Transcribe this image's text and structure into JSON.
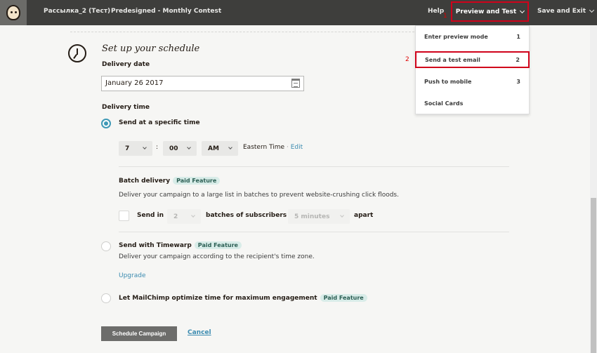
{
  "topbar": {
    "campaign_name": "Рассылка_2 (Тест)",
    "template_name": "Predesigned - Monthly Contest",
    "help_label": "Help",
    "preview_label": "Preview and Test",
    "save_exit_label": "Save and Exit",
    "annotation_1": "1"
  },
  "dropdown": {
    "annotation_2": "2",
    "items": [
      {
        "label": "Enter preview mode",
        "num": "1"
      },
      {
        "label": "Send a test email",
        "num": "2"
      },
      {
        "label": "Push to mobile",
        "num": "3"
      },
      {
        "label": "Social Cards",
        "num": ""
      }
    ]
  },
  "schedule": {
    "title": "Set up your schedule",
    "delivery_date_label": "Delivery date",
    "delivery_date_value": "January 26 2017",
    "delivery_time_label": "Delivery time",
    "specific_time_label": "Send at a specific time",
    "hour": "7",
    "minute": "00",
    "ampm": "AM",
    "timezone": "Eastern Time",
    "timezone_sep": " · ",
    "edit_label": "Edit"
  },
  "batch": {
    "title": "Batch delivery",
    "paid_label": "Paid Feature",
    "description": "Deliver your campaign to a large list in batches to prevent website-crushing click floods.",
    "send_in_label": "Send in",
    "batches_count": "2",
    "batches_of_label": "batches of subscribers",
    "interval": "5 minutes",
    "apart_label": "apart"
  },
  "timewarp": {
    "title": "Send with Timewarp",
    "paid_label": "Paid Feature",
    "description": "Deliver your campaign according to the recipient's time zone.",
    "upgrade_label": "Upgrade"
  },
  "optimize": {
    "title": "Let MailChimp optimize time for maximum engagement",
    "paid_label": "Paid Feature"
  },
  "actions": {
    "schedule_label": "Schedule Campaign",
    "cancel_label": "Cancel"
  },
  "colors": {
    "topbar_bg": "#3e3e3c",
    "highlight_red": "#d0021b",
    "accent_teal": "#3f99b6",
    "link_blue": "#3b8bb0"
  }
}
